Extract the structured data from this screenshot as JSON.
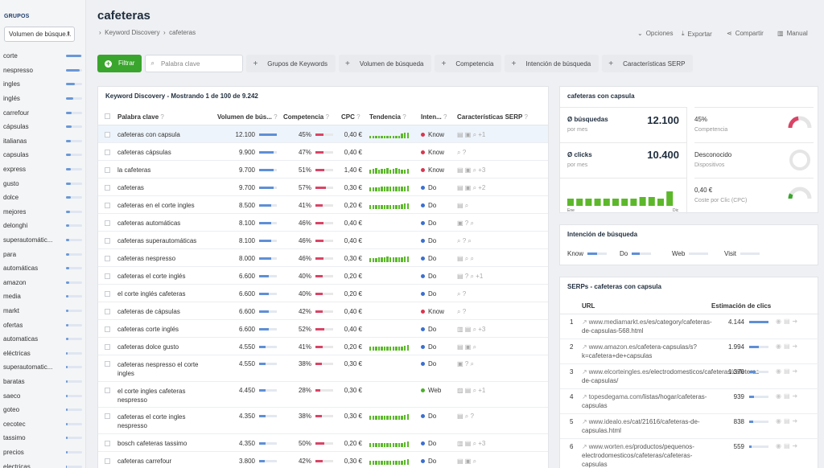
{
  "sidebar": {
    "title": "GRUPOS",
    "select": "Volumen de búsque...",
    "items": [
      {
        "label": "corte",
        "v": 0.95
      },
      {
        "label": "nespresso",
        "v": 0.85
      },
      {
        "label": "ingles",
        "v": 0.55
      },
      {
        "label": "inglés",
        "v": 0.45
      },
      {
        "label": "carrefour",
        "v": 0.35
      },
      {
        "label": "cápsulas",
        "v": 0.35
      },
      {
        "label": "italianas",
        "v": 0.3
      },
      {
        "label": "capsulas",
        "v": 0.3
      },
      {
        "label": "express",
        "v": 0.3
      },
      {
        "label": "gusto",
        "v": 0.28
      },
      {
        "label": "dolce",
        "v": 0.28
      },
      {
        "label": "mejores",
        "v": 0.25
      },
      {
        "label": "delonghi",
        "v": 0.22
      },
      {
        "label": "superautomátic...",
        "v": 0.2
      },
      {
        "label": "para",
        "v": 0.2
      },
      {
        "label": "automáticas",
        "v": 0.18
      },
      {
        "label": "amazon",
        "v": 0.18
      },
      {
        "label": "media",
        "v": 0.15
      },
      {
        "label": "markt",
        "v": 0.15
      },
      {
        "label": "ofertas",
        "v": 0.15
      },
      {
        "label": "automaticas",
        "v": 0.13
      },
      {
        "label": "eléctricas",
        "v": 0.12
      },
      {
        "label": "superautomatic...",
        "v": 0.12
      },
      {
        "label": "baratas",
        "v": 0.1
      },
      {
        "label": "saeco",
        "v": 0.1
      },
      {
        "label": "goteo",
        "v": 0.1
      },
      {
        "label": "cecotec",
        "v": 0.08
      },
      {
        "label": "tassimo",
        "v": 0.08
      },
      {
        "label": "precios",
        "v": 0.08
      },
      {
        "label": "electricas",
        "v": 0.07
      }
    ]
  },
  "header": {
    "title": "cafeteras",
    "breadcrumb": [
      "Keyword Discovery",
      "cafeteras"
    ],
    "actions": [
      "Opciones",
      "Exportar",
      "Compartir",
      "Manual"
    ]
  },
  "toolbar": {
    "filter": "Filtrar",
    "keyword_placeholder": "Palabra clave",
    "buttons": [
      "Grupos de Keywords",
      "Volumen de búsqueda",
      "Competencia",
      "Intención de búsqueda",
      "Características SERP"
    ]
  },
  "table": {
    "title": "Keyword Discovery - Mostrando 1 de 100 de 9.242",
    "headers": [
      "Palabra clave",
      "Volumen de bús...",
      "Competencia",
      "CPC",
      "Tendencia",
      "Inten...",
      "Características SERP"
    ],
    "rows": [
      {
        "kw": "cafeteras con capsula",
        "vol": "12.100",
        "vr": 1.0,
        "comp": "45%",
        "cr": 0.45,
        "cpc": "0,40 €",
        "intent": "Know",
        "trend": [
          0.35,
          0.35,
          0.35,
          0.35,
          0.35,
          0.35,
          0.35,
          0.35,
          0.35,
          0.35,
          0.35,
          0.6,
          0.7,
          0.7
        ],
        "serp": "▤ ▣ ⌕ +1"
      },
      {
        "kw": "cafeteras cápsulas",
        "vol": "9.900",
        "vr": 0.82,
        "comp": "47%",
        "cr": 0.47,
        "cpc": "0,40 €",
        "intent": "Know",
        "trend": [],
        "serp": "⌕ ?"
      },
      {
        "kw": "la cafeteras",
        "vol": "9.700",
        "vr": 0.8,
        "comp": "51%",
        "cr": 0.51,
        "cpc": "1,40 €",
        "intent": "Know",
        "trend": [
          0.5,
          0.6,
          0.7,
          0.5,
          0.6,
          0.6,
          0.7,
          0.5,
          0.6,
          0.7,
          0.6,
          0.5,
          0.5,
          0.6
        ],
        "serp": "▤ ▣ ⌕ +3"
      },
      {
        "kw": "cafeteras",
        "vol": "9.700",
        "vr": 0.8,
        "comp": "57%",
        "cr": 0.57,
        "cpc": "0,30 €",
        "intent": "Do",
        "trend": [
          0.5,
          0.5,
          0.5,
          0.5,
          0.6,
          0.6,
          0.6,
          0.6,
          0.6,
          0.6,
          0.6,
          0.6,
          0.6,
          0.7
        ],
        "serp": "▤ ▣ ⌕ +2"
      },
      {
        "kw": "cafeteras en el corte ingles",
        "vol": "8.500",
        "vr": 0.7,
        "comp": "41%",
        "cr": 0.41,
        "cpc": "0,20 €",
        "intent": "Do",
        "trend": [
          0.5,
          0.5,
          0.5,
          0.5,
          0.5,
          0.5,
          0.5,
          0.5,
          0.5,
          0.5,
          0.5,
          0.6,
          0.7,
          0.7
        ],
        "serp": "▤ ⌕"
      },
      {
        "kw": "cafeteras automáticas",
        "vol": "8.100",
        "vr": 0.67,
        "comp": "46%",
        "cr": 0.46,
        "cpc": "0,40 €",
        "intent": "Do",
        "trend": [],
        "serp": "▣ ? ⌕"
      },
      {
        "kw": "cafeteras superautomáticas",
        "vol": "8.100",
        "vr": 0.67,
        "comp": "46%",
        "cr": 0.46,
        "cpc": "0,40 €",
        "intent": "Do",
        "trend": [],
        "serp": "⌕ ? ⌕"
      },
      {
        "kw": "cafeteras nespresso",
        "vol": "8.000",
        "vr": 0.66,
        "comp": "46%",
        "cr": 0.46,
        "cpc": "0,30 €",
        "intent": "Do",
        "trend": [
          0.5,
          0.5,
          0.5,
          0.6,
          0.6,
          0.6,
          0.7,
          0.6,
          0.6,
          0.6,
          0.6,
          0.6,
          0.7,
          0.7
        ],
        "serp": "▤ ⌕ ⌕"
      },
      {
        "kw": "cafeteras el corte inglés",
        "vol": "6.600",
        "vr": 0.55,
        "comp": "40%",
        "cr": 0.4,
        "cpc": "0,20 €",
        "intent": "Do",
        "trend": [],
        "serp": "▤ ? ⌕ +1"
      },
      {
        "kw": "el corte inglés cafeteras",
        "vol": "6.600",
        "vr": 0.55,
        "comp": "40%",
        "cr": 0.4,
        "cpc": "0,20 €",
        "intent": "Do",
        "trend": [],
        "serp": "⌕ ?"
      },
      {
        "kw": "cafeteras de cápsulas",
        "vol": "6.600",
        "vr": 0.55,
        "comp": "42%",
        "cr": 0.42,
        "cpc": "0,40 €",
        "intent": "Know",
        "trend": [],
        "serp": "⌕ ?"
      },
      {
        "kw": "cafeteras corte inglés",
        "vol": "6.600",
        "vr": 0.55,
        "comp": "52%",
        "cr": 0.52,
        "cpc": "0,40 €",
        "intent": "Do",
        "trend": [],
        "serp": "▥ ▤ ⌕ +3"
      },
      {
        "kw": "cafeteras dolce gusto",
        "vol": "4.550",
        "vr": 0.38,
        "comp": "41%",
        "cr": 0.41,
        "cpc": "0,20 €",
        "intent": "Do",
        "trend": [
          0.5,
          0.5,
          0.5,
          0.5,
          0.5,
          0.5,
          0.5,
          0.5,
          0.5,
          0.5,
          0.5,
          0.5,
          0.6,
          0.7
        ],
        "serp": "▤ ▣ ⌕"
      },
      {
        "kw": "cafeteras nespresso el corte ingles",
        "vol": "4.550",
        "vr": 0.38,
        "comp": "38%",
        "cr": 0.38,
        "cpc": "0,30 €",
        "intent": "Do",
        "trend": [],
        "serp": "▣ ? ⌕",
        "tall": true
      },
      {
        "kw": "el corte ingles cafeteras nespresso",
        "vol": "4.450",
        "vr": 0.37,
        "comp": "28%",
        "cr": 0.28,
        "cpc": "0,30 €",
        "intent": "Web",
        "trend": [],
        "serp": "▨ ▤ ⌕ +1",
        "tall": true
      },
      {
        "kw": "cafeteras el corte ingles nespresso",
        "vol": "4.350",
        "vr": 0.36,
        "comp": "38%",
        "cr": 0.38,
        "cpc": "0,30 €",
        "intent": "Do",
        "trend": [
          0.5,
          0.5,
          0.5,
          0.5,
          0.5,
          0.5,
          0.5,
          0.5,
          0.5,
          0.5,
          0.5,
          0.5,
          0.6,
          0.7
        ],
        "serp": "▤ ⌕ ?",
        "tall": true
      },
      {
        "kw": "bosch cafeteras tassimo",
        "vol": "4.350",
        "vr": 0.36,
        "comp": "50%",
        "cr": 0.5,
        "cpc": "0,20 €",
        "intent": "Do",
        "trend": [
          0.5,
          0.5,
          0.5,
          0.5,
          0.5,
          0.5,
          0.5,
          0.5,
          0.5,
          0.5,
          0.5,
          0.5,
          0.6,
          0.7
        ],
        "serp": "▥ ▤ ⌕ +3"
      },
      {
        "kw": "cafeteras carrefour",
        "vol": "3.800",
        "vr": 0.31,
        "comp": "42%",
        "cr": 0.42,
        "cpc": "0,30 €",
        "intent": "Do",
        "trend": [
          0.5,
          0.5,
          0.5,
          0.5,
          0.5,
          0.5,
          0.5,
          0.5,
          0.5,
          0.5,
          0.5,
          0.5,
          0.6,
          0.7
        ],
        "serp": "▤ ▣ ⌕"
      }
    ]
  },
  "overview": {
    "title": "cafeteras con capsula",
    "busquedas_label": "Ø búsquedas",
    "busquedas_sub": "por mes",
    "busquedas": "12.100",
    "clicks_label": "Ø clicks",
    "clicks_sub": "por mes",
    "clicks": "10.400",
    "competencia_value": "45%",
    "competencia_label": "Competencia",
    "competencia": 0.45,
    "dispositivos_value": "Desconocido",
    "dispositivos_label": "Dispositivos",
    "cpc_value": "0,40 €",
    "cpc_label": "Coste por Clic (CPC)",
    "cpc_level": 0.15,
    "chart_from": "Ene",
    "chart_to": "Dic",
    "monthly": [
      0.45,
      0.45,
      0.45,
      0.45,
      0.45,
      0.45,
      0.45,
      0.45,
      0.55,
      0.55,
      0.45,
      0.9
    ]
  },
  "intent": {
    "title": "Intención de búsqueda",
    "items": [
      {
        "label": "Know",
        "v": 0.5
      },
      {
        "label": "Do",
        "v": 0.4
      },
      {
        "label": "Web",
        "v": 0
      },
      {
        "label": "Visit",
        "v": 0
      }
    ]
  },
  "serps": {
    "title": "SERPs - cafeteras con capsula",
    "col_url": "URL",
    "col_clicks": "Estimación de clics",
    "rows": [
      {
        "n": "1",
        "dom": "www.mediamarkt.es",
        "path": "/es/category/cafeteras-de-capsulas-568.html",
        "clicks": "4.144",
        "r": 1.0
      },
      {
        "n": "2",
        "dom": "www.amazon.es",
        "path": "/cafetera-capsulas/s?k=cafetera+de+capsulas",
        "clicks": "1.994",
        "r": 0.48
      },
      {
        "n": "3",
        "dom": "www.elcorteingles.es",
        "path": "/electrodomesticos/cafeteras/cafeteras-de-capsulas/",
        "clicks": "1.370",
        "r": 0.33
      },
      {
        "n": "4",
        "dom": "topesdegama.com",
        "path": "/listas/hogar/cafeteras-capsulas",
        "clicks": "939",
        "r": 0.23
      },
      {
        "n": "5",
        "dom": "www.idealo.es",
        "path": "/cat/21616/cafeteras-de-capsulas.html",
        "clicks": "838",
        "r": 0.2
      },
      {
        "n": "6",
        "dom": "www.worten.es",
        "path": "/productos/pequenos-electrodomesticos/cafeteras/cafeteras-capsulas",
        "clicks": "559",
        "r": 0.13
      }
    ]
  }
}
